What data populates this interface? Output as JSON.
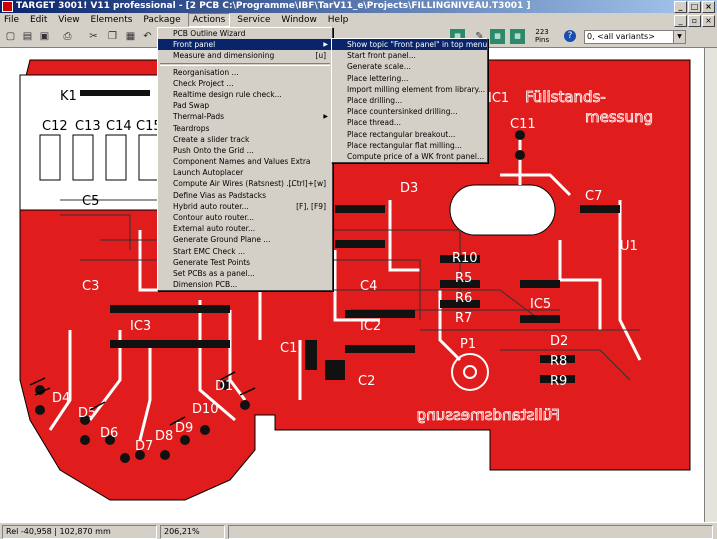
{
  "window": {
    "title": "TARGET 3001! V11 professional - [2 PCB C:\\Programme\\IBF\\TarV11_e\\Projects\\FILLINGNIVEAU.T3001 ]"
  },
  "menubar": [
    "File",
    "Edit",
    "View",
    "Elements",
    "Package",
    "Actions",
    "Service",
    "Window",
    "Help"
  ],
  "toolbar": {
    "pins_count": "223",
    "pins_label": "Pins",
    "variant": "0, <all variants>"
  },
  "actions_menu": [
    {
      "label": "PCB Outline Wizard"
    },
    {
      "label": "Front panel",
      "submenu": true,
      "highlighted": true
    },
    {
      "label": "Measure and dimensioning",
      "shortcut": "[u]"
    },
    {
      "sep": true
    },
    {
      "label": "Reorganisation ..."
    },
    {
      "label": "Check Project ..."
    },
    {
      "label": "Realtime design rule check..."
    },
    {
      "label": "Pad Swap"
    },
    {
      "label": "Thermal-Pads",
      "submenu": true
    },
    {
      "label": "Teardrops"
    },
    {
      "label": "Create a slider track"
    },
    {
      "label": "Push Onto the Grid ..."
    },
    {
      "label": "Component Names and Values Extra"
    },
    {
      "label": "Launch Autoplacer"
    },
    {
      "label": "Compute Air Wires (Ratsnest) ...",
      "shortcut": "[Ctrl]+[w]"
    },
    {
      "label": "Define Vias as Padstacks"
    },
    {
      "label": "Hybrid auto router...",
      "shortcut": "[F], [F9]"
    },
    {
      "label": "Contour auto router..."
    },
    {
      "label": "External auto router..."
    },
    {
      "label": "Generate Ground Plane ..."
    },
    {
      "label": "Start EMC Check ..."
    },
    {
      "label": "Generate Test Points"
    },
    {
      "label": "Set PCBs as a panel..."
    },
    {
      "label": "Dimension PCB..."
    }
  ],
  "front_panel_menu": [
    {
      "label": "Show topic \"Front panel\" in top menu",
      "highlighted": true
    },
    {
      "label": "Start front panel..."
    },
    {
      "label": "Generate scale..."
    },
    {
      "label": "Place lettering..."
    },
    {
      "label": "Import milling element from library..."
    },
    {
      "label": "Place drilling..."
    },
    {
      "label": "Place countersinked drilling..."
    },
    {
      "label": "Place thread..."
    },
    {
      "label": "Place rectangular breakout..."
    },
    {
      "label": "Place rectangular flat milling..."
    },
    {
      "label": "Compute price of a WK front panel..."
    }
  ],
  "pcb_labels": {
    "k1": "K1",
    "c12": "C12",
    "c13": "C13",
    "c14": "C14",
    "c15": "C15",
    "c5": "C5",
    "c11": "C11",
    "c7": "C7",
    "c3": "C3",
    "ic1": "IC1",
    "ic3": "IC3",
    "ic2": "IC2",
    "p1": "P1",
    "r5": "R5",
    "r6": "R6",
    "r7": "R7",
    "r10": "R10",
    "r9": "R9",
    "r8": "R8",
    "d1": "D1",
    "d2": "D2",
    "d3": "D3",
    "d4": "D4",
    "d5": "D5",
    "d6": "D6",
    "d7": "D7",
    "d8": "D8",
    "d9": "D9",
    "d10": "D10",
    "c1": "C1",
    "c2": "C2",
    "c4": "C4",
    "u1": "U1",
    "ic5": "IC5",
    "title_top": "Füllstands-",
    "title_bottom": "messung",
    "mirror_text": "Füllstandsmessung"
  },
  "status": {
    "coords": "Rel -40,958 | 102,870 mm",
    "zoom": "206,21%"
  },
  "colors": {
    "board": "#e01c1c",
    "titlebar": "#0a246a",
    "highlight": "#0a246a"
  }
}
